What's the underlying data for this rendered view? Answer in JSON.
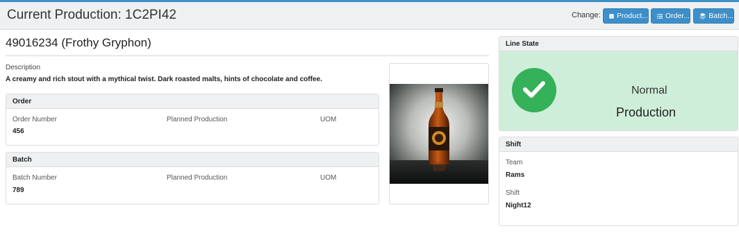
{
  "header": {
    "title": "Current Production: 1C2PI42",
    "change_label": "Change:",
    "buttons": {
      "product": "Product...",
      "order": "Order...",
      "batch": "Batch..."
    }
  },
  "product": {
    "title": "49016234 (Frothy Gryphon)",
    "description_label": "Description",
    "description": "A creamy and rich stout with a mythical twist. Dark roasted malts, hints of chocolate and coffee."
  },
  "order": {
    "heading": "Order",
    "order_number_label": "Order Number",
    "order_number": "456",
    "planned_label": "Planned Production",
    "uom_label": "UOM"
  },
  "batch": {
    "heading": "Batch",
    "batch_number_label": "Batch Number",
    "batch_number": "789",
    "planned_label": "Planned Production",
    "uom_label": "UOM"
  },
  "line_state": {
    "heading": "Line State",
    "status": "Normal",
    "state": "Production",
    "color": "#cfeed9",
    "icon": "check-icon"
  },
  "shift": {
    "heading": "Shift",
    "team_label": "Team",
    "team": "Rams",
    "shift_label": "Shift",
    "shift": "Night12"
  },
  "colors": {
    "accent": "#3d8fc9",
    "ok": "#34b159"
  }
}
